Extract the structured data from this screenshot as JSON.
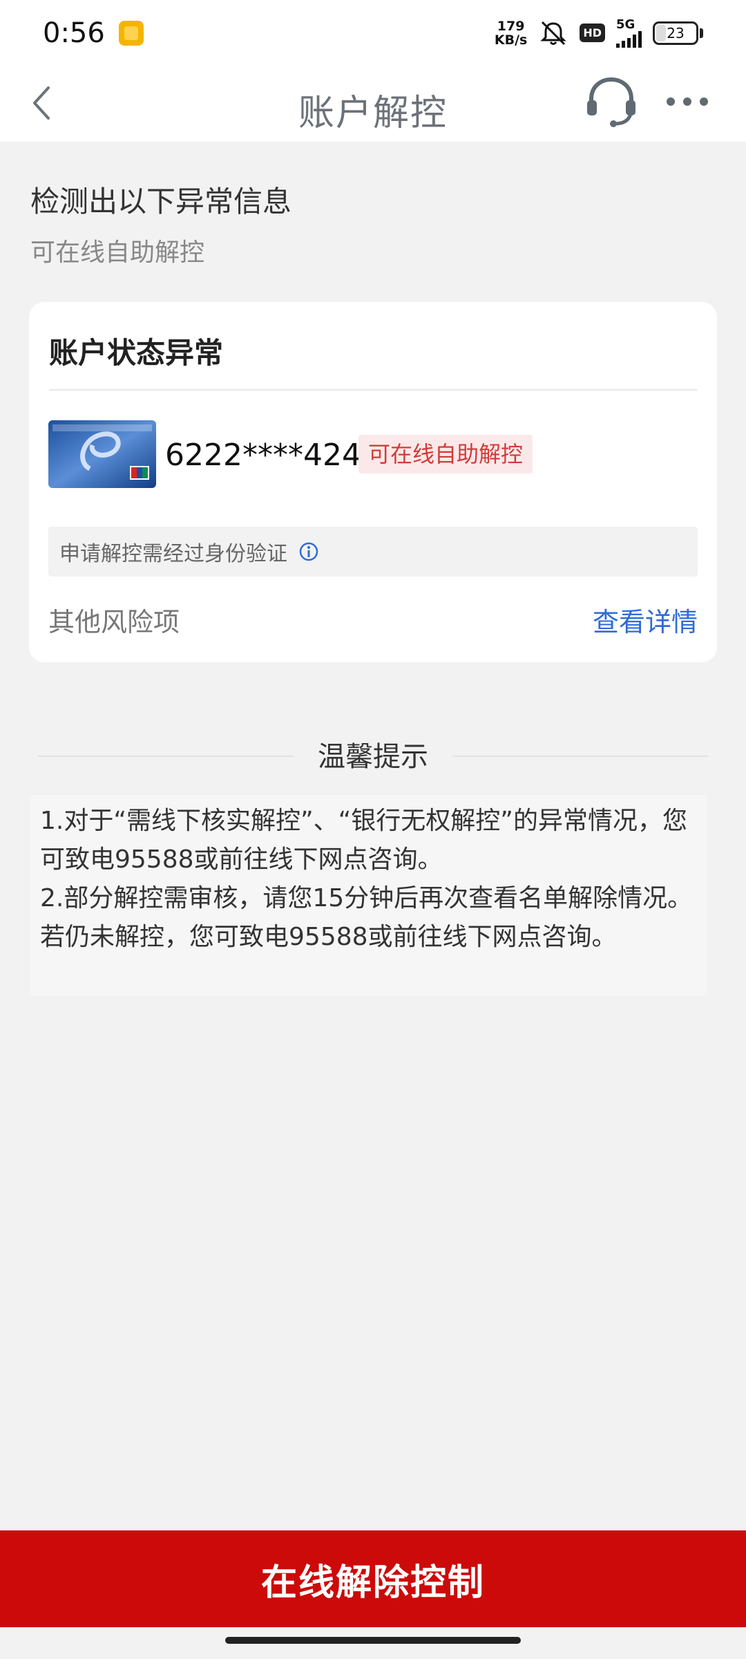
{
  "status_bar": {
    "time": "0:56",
    "net_speed_value": "179",
    "net_speed_unit": "KB/s",
    "hd": "HD",
    "network": "5G",
    "battery": "23",
    "battery_level": 0.23
  },
  "nav": {
    "title": "账户解控",
    "back_icon": "chevron-left-icon",
    "service_icon": "headset-icon",
    "more_icon": "more-dots-icon"
  },
  "header": {
    "title": "检测出以下异常信息",
    "subtitle": "可在线自助解控"
  },
  "card": {
    "title": "账户状态异常",
    "account_number": "6222****4243",
    "status_tag": "可在线自助解控",
    "verify_text": "申请解控需经过身份验证",
    "other_risk_label": "其他风险项",
    "view_detail_link": "查看详情"
  },
  "tips": {
    "title": "温馨提示",
    "items": [
      "1.对于“需线下核实解控”、“银行无权解控”的异常情况，您可致电95588或前往线下网点咨询。",
      "2.部分解控需审核，请您15分钟后再次查看名单解除情况。若仍未解控，您可致电95588或前往线下网点咨询。"
    ]
  },
  "bottom": {
    "button_label": "在线解除控制"
  },
  "colors": {
    "primary_red": "#cc0a0a",
    "tag_red": "#d43a3a",
    "link_blue": "#2f6bd8",
    "background": "#f2f2f2"
  }
}
